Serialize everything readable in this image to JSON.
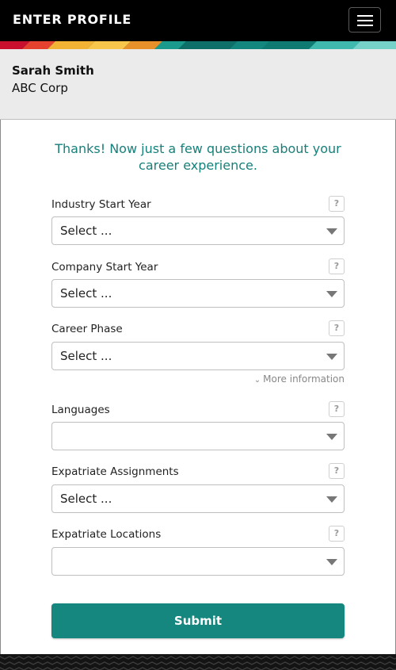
{
  "header": {
    "title": "ENTER PROFILE",
    "menu_icon": "hamburger-menu-icon"
  },
  "profile": {
    "name": "Sarah Smith",
    "company": "ABC Corp"
  },
  "intro_text": "Thanks! Now just a few questions about your career experience.",
  "fields": [
    {
      "label": "Industry Start Year",
      "value": "Select ...",
      "help": "?"
    },
    {
      "label": "Company Start Year",
      "value": "Select ...",
      "help": "?"
    },
    {
      "label": "Career Phase",
      "value": "Select ...",
      "help": "?"
    },
    {
      "label": "Languages",
      "value": "",
      "help": "?"
    },
    {
      "label": "Expatriate Assignments",
      "value": "Select ...",
      "help": "?"
    },
    {
      "label": "Expatriate Locations",
      "value": "",
      "help": "?"
    }
  ],
  "more_info_label": "More information",
  "submit_label": "Submit",
  "colors": {
    "accent": "#15877f",
    "header_bg": "#000000",
    "profile_bg": "#ebebeb"
  }
}
